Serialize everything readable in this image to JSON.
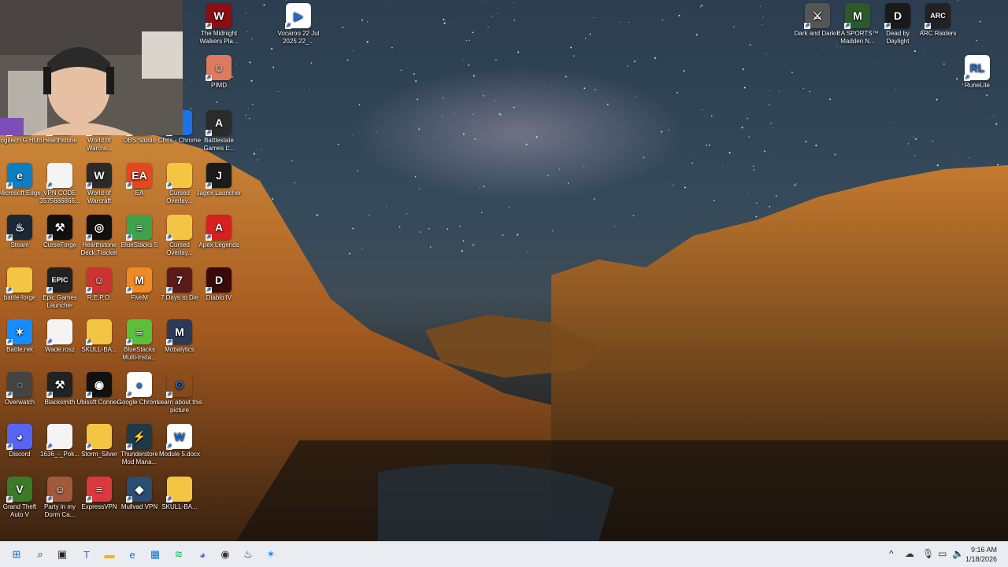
{
  "desktop": {
    "icons": [
      {
        "label": "Logitech G HUB",
        "color": "#111",
        "glyph": "G"
      },
      {
        "label": "Hearthstone",
        "color": "#8b5a2b",
        "glyph": "H"
      },
      {
        "label": "World of Warcra...",
        "color": "#333",
        "glyph": "W"
      },
      {
        "label": "OBS Studio",
        "color": "#222",
        "glyph": "◉"
      },
      {
        "label": "Chris - Chrome",
        "color": "#1a73e8",
        "glyph": "●"
      },
      {
        "label": "Battlestate Games L...",
        "color": "#2b2b2b",
        "glyph": "A"
      },
      {
        "label": "Microsoft Edge",
        "color": "#0c7ec6",
        "glyph": "e"
      },
      {
        "label": "VPN CODE 3575686866...",
        "color": "#f4f4f4",
        "glyph": ""
      },
      {
        "label": "World of Warcraft",
        "color": "#2a2a2a",
        "glyph": "W"
      },
      {
        "label": "EA",
        "color": "#e8461e",
        "glyph": "EA"
      },
      {
        "label": "Cursed Overlay...",
        "color": "#f4c542",
        "glyph": ""
      },
      {
        "label": "Jagex Launcher",
        "color": "#1b1b1b",
        "glyph": "J"
      },
      {
        "label": "Steam",
        "color": "#1b2838",
        "glyph": "♨"
      },
      {
        "label": "CurseForge",
        "color": "#111",
        "glyph": "⚒"
      },
      {
        "label": "Hearthstone Deck Tracker",
        "color": "#111",
        "glyph": "◎"
      },
      {
        "label": "BlueStacks 5",
        "color": "#3fa34d",
        "glyph": "≡"
      },
      {
        "label": "Cursed Overlay...",
        "color": "#f4c542",
        "glyph": ""
      },
      {
        "label": "Apex Legends",
        "color": "#d7201f",
        "glyph": "A"
      },
      {
        "label": "battle-forge",
        "color": "#f4c542",
        "glyph": ""
      },
      {
        "label": "Epic Games Launcher",
        "color": "#222",
        "glyph": "EPIC"
      },
      {
        "label": "R.E.P.O.",
        "color": "#c33",
        "glyph": "☺"
      },
      {
        "label": "FiveM",
        "color": "#f08a24",
        "glyph": "M"
      },
      {
        "label": "7 Days to Die",
        "color": "#5a1a1a",
        "glyph": "7"
      },
      {
        "label": "Diablo IV",
        "color": "#3a0a0a",
        "glyph": "D"
      },
      {
        "label": "Battle.net",
        "color": "#148eff",
        "glyph": "✶"
      },
      {
        "label": "Wade.rosz",
        "color": "#f4f4f4",
        "glyph": ""
      },
      {
        "label": "SKULL-BA...",
        "color": "#f4c542",
        "glyph": ""
      },
      {
        "label": "BlueStacks Multi-Insta...",
        "color": "#5bbf3b",
        "glyph": "≡"
      },
      {
        "label": "Mobalytics",
        "color": "#2c3a5a",
        "glyph": "M"
      },
      {
        "label": "",
        "color": "",
        "glyph": ""
      },
      {
        "label": "Overwatch",
        "color": "#444",
        "glyph": "◌"
      },
      {
        "label": "Blacksmith",
        "color": "#222",
        "glyph": "⚒"
      },
      {
        "label": "Ubisoft Connect",
        "color": "#111",
        "glyph": "◉"
      },
      {
        "label": "Google Chrome",
        "color": "#fff",
        "glyph": "●"
      },
      {
        "label": "Learn about this picture",
        "color": "transparent",
        "glyph": "⊙"
      },
      {
        "label": "",
        "color": "",
        "glyph": ""
      },
      {
        "label": "Discord",
        "color": "#5865f2",
        "glyph": "◕"
      },
      {
        "label": "1636_-_Pok...",
        "color": "#f4f4f4",
        "glyph": ""
      },
      {
        "label": "Storm_Silver",
        "color": "#f4c542",
        "glyph": ""
      },
      {
        "label": "Thunderstore Mod Mana...",
        "color": "#1d3a4a",
        "glyph": "⚡"
      },
      {
        "label": "Module 5.docx",
        "color": "#fff",
        "glyph": "W"
      },
      {
        "label": "",
        "color": "",
        "glyph": ""
      },
      {
        "label": "Grand Theft Auto V",
        "color": "#3c7a2a",
        "glyph": "V"
      },
      {
        "label": "Party in my Dorm Ca...",
        "color": "#a05a3a",
        "glyph": "☺"
      },
      {
        "label": "ExpressVPN",
        "color": "#da3940",
        "glyph": "≡"
      },
      {
        "label": "Mullvad VPN",
        "color": "#294d73",
        "glyph": "◆"
      },
      {
        "label": "SKULL-BA...",
        "color": "#f4c542",
        "glyph": ""
      }
    ],
    "col2_top": [
      {
        "label": "The Midnight Walkers Pla...",
        "color": "#8a0e12",
        "glyph": "W"
      },
      {
        "label": "PIMD",
        "color": "#e07a5f",
        "glyph": "☺"
      }
    ],
    "partial_top": [
      {
        "label": "...an...",
        "color": "#c22"
      },
      {
        "label": "...pdf",
        "color": "#f4c542"
      }
    ],
    "vocaroo": {
      "label": "Vocaroo 22 Jul 2025 22_...",
      "color": "#fff",
      "glyph": "▶"
    },
    "right_icons": [
      {
        "label": "Dark and Darker",
        "color": "#555",
        "glyph": "⚔"
      },
      {
        "label": "EA SPORTS™ Madden N...",
        "color": "#2a5a2a",
        "glyph": "M"
      },
      {
        "label": "Dead by Daylight",
        "color": "#1a1a1a",
        "glyph": "D"
      },
      {
        "label": "ARC Raiders",
        "color": "#222",
        "glyph": "ARC"
      },
      {
        "label": "RuneLite",
        "color": "#fff",
        "glyph": "RL"
      }
    ]
  },
  "taskbar": {
    "apps": [
      {
        "name": "start-button",
        "glyph": "⊞",
        "color": "#0078d4"
      },
      {
        "name": "search-icon",
        "glyph": "⌕",
        "color": "#222"
      },
      {
        "name": "task-view-icon",
        "glyph": "▣",
        "color": "#222"
      },
      {
        "name": "teams-icon",
        "glyph": "T",
        "color": "#5b5fc7"
      },
      {
        "name": "file-explorer-icon",
        "glyph": "▬",
        "color": "#f4b400"
      },
      {
        "name": "edge-icon",
        "glyph": "e",
        "color": "#0c7ec6"
      },
      {
        "name": "store-icon",
        "glyph": "▦",
        "color": "#0078d4"
      },
      {
        "name": "spotify-icon",
        "glyph": "≋",
        "color": "#1db954"
      },
      {
        "name": "discord-icon",
        "glyph": "◕",
        "color": "#5865f2"
      },
      {
        "name": "app-icon",
        "glyph": "◉",
        "color": "#333"
      },
      {
        "name": "steam-icon",
        "glyph": "♨",
        "color": "#1b2838"
      },
      {
        "name": "battlenet-icon",
        "glyph": "✶",
        "color": "#148eff"
      }
    ],
    "tray": {
      "chevron": "^",
      "time": "9:16 AM",
      "date": "1/18/2026"
    }
  }
}
